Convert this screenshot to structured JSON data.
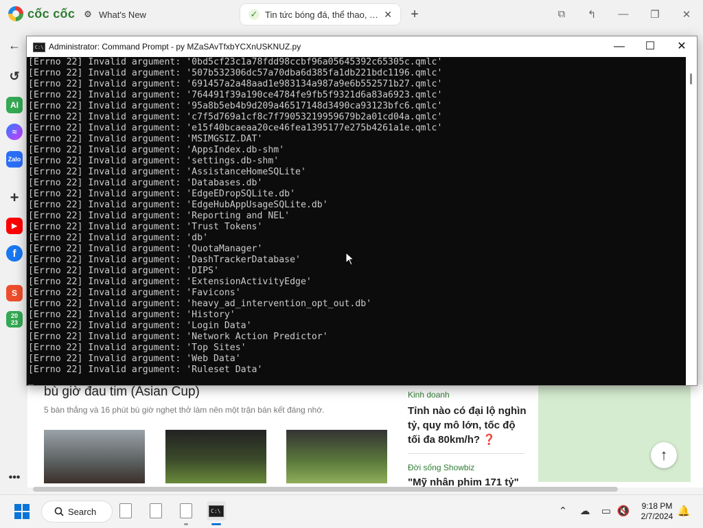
{
  "browser": {
    "brand": "cốc cốc",
    "tabs": [
      {
        "title": "What's New",
        "active": false
      },
      {
        "title": "Tin tức bóng đá, thể thao, giải trí",
        "active": true
      }
    ],
    "sidebar_icons": [
      "history-icon",
      "ai-icon",
      "messenger-icon",
      "zalo-icon",
      "add-icon",
      "youtube-icon",
      "facebook-icon",
      "shopee-icon",
      "calendar-icon",
      "more-icon"
    ]
  },
  "cmd": {
    "title": "Administrator: Command Prompt - py  MZaSAvTfxbYCXnUSKNUZ.py",
    "lines": [
      "[Errno 22] Invalid argument: '0bd5cf23c1a78fdd98ccbf96a05645392c65305c.qmlc'",
      "[Errno 22] Invalid argument: '507b532306dc57a70dba6d385fa1db221bdc1196.qmlc'",
      "[Errno 22] Invalid argument: '691457a2a48aad1e983134a987a9e6b552571b27.qmlc'",
      "[Errno 22] Invalid argument: '764491f39a190ce4784fe9fb5f9321d6a83a6923.qmlc'",
      "[Errno 22] Invalid argument: '95a8b5eb4b9d209a46517148d3490ca93123bfc6.qmlc'",
      "[Errno 22] Invalid argument: 'c7f5d769a1cf8c7f79053219959679b2a01cd04a.qmlc'",
      "[Errno 22] Invalid argument: 'e15f40bcaeaa20ce46fea1395177e275b4261a1e.qmlc'",
      "[Errno 22] Invalid argument: 'MSIMGSIZ.DAT'",
      "[Errno 22] Invalid argument: 'AppsIndex.db-shm'",
      "[Errno 22] Invalid argument: 'settings.db-shm'",
      "[Errno 22] Invalid argument: 'AssistanceHomeSQLite'",
      "[Errno 22] Invalid argument: 'Databases.db'",
      "[Errno 22] Invalid argument: 'EdgeEDropSQLite.db'",
      "[Errno 22] Invalid argument: 'EdgeHubAppUsageSQLite.db'",
      "[Errno 22] Invalid argument: 'Reporting and NEL'",
      "[Errno 22] Invalid argument: 'Trust Tokens'",
      "[Errno 22] Invalid argument: 'db'",
      "[Errno 22] Invalid argument: 'QuotaManager'",
      "[Errno 22] Invalid argument: 'DashTrackerDatabase'",
      "[Errno 22] Invalid argument: 'DIPS'",
      "[Errno 22] Invalid argument: 'ExtensionActivityEdge'",
      "[Errno 22] Invalid argument: 'Favicons'",
      "[Errno 22] Invalid argument: 'heavy_ad_intervention_opt_out.db'",
      "[Errno 22] Invalid argument: 'History'",
      "[Errno 22] Invalid argument: 'Login Data'",
      "[Errno 22] Invalid argument: 'Network Action Predictor'",
      "[Errno 22] Invalid argument: 'Top Sites'",
      "[Errno 22] Invalid argument: 'Web Data'",
      "[Errno 22] Invalid argument: 'Ruleset Data'"
    ]
  },
  "page": {
    "headline": "bù giờ đau tim (Asian Cup)",
    "summary": "5 bàn thắng và 16 phút bù giờ nghẹt thở làm nên một trận bán kết đáng nhớ.",
    "side_items": [
      {
        "category": "Kinh doanh",
        "title": "Tỉnh nào có đại lộ nghìn tỷ, quy mô lớn, tốc độ tối đa 80km/h? ❓"
      },
      {
        "category": "Đời sống Showbiz",
        "title": "\"Mỹ nhân phim 171 tỷ\""
      }
    ]
  },
  "taskbar": {
    "search_label": "Search",
    "time": "9:18 PM",
    "date": "2/7/2024"
  }
}
